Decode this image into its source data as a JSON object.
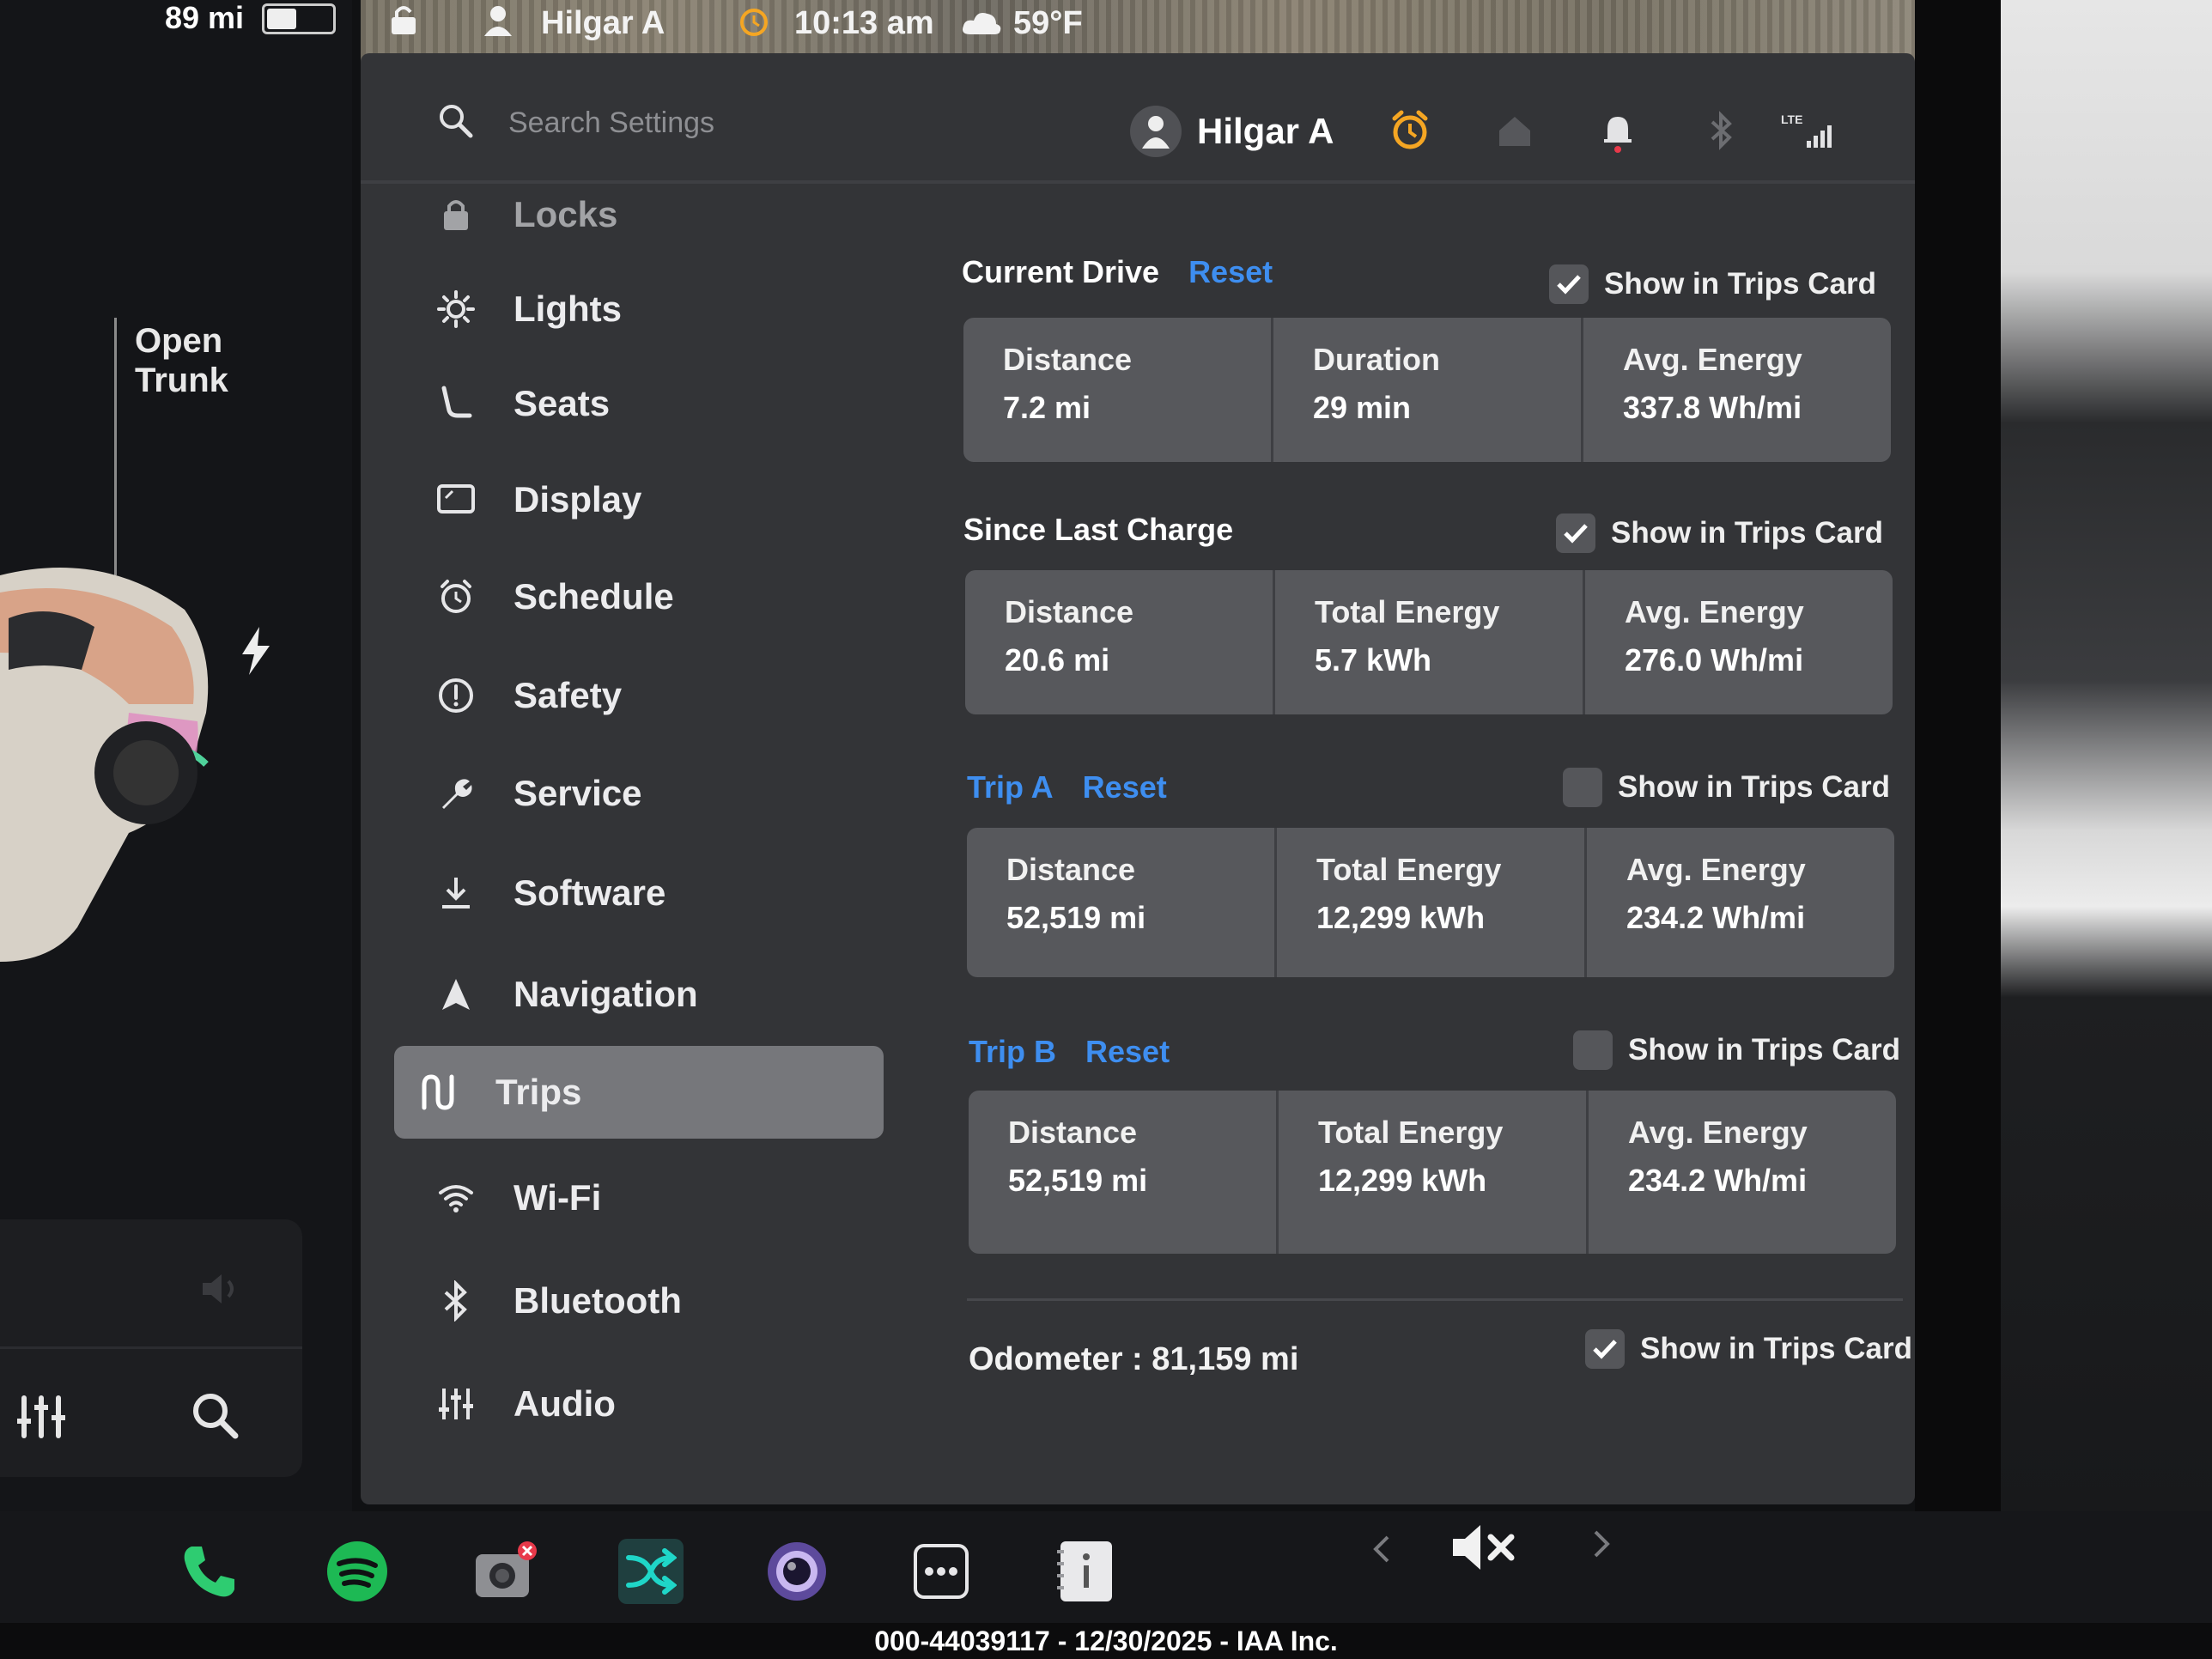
{
  "status_bar": {
    "range": "89 mi",
    "battery_level": 0.45,
    "user": "Hilgar A",
    "time": "10:13 am",
    "temperature": "59°F"
  },
  "left_panel": {
    "trunk_label_1": "Open",
    "trunk_label_2": "Trunk"
  },
  "header": {
    "search_placeholder": "Search Settings",
    "profile_name": "Hilgar A",
    "lte_label": "LTE"
  },
  "sidebar": {
    "items": [
      {
        "label": "Locks",
        "icon": "lock-icon"
      },
      {
        "label": "Lights",
        "icon": "sun-icon"
      },
      {
        "label": "Seats",
        "icon": "seat-icon"
      },
      {
        "label": "Display",
        "icon": "display-icon"
      },
      {
        "label": "Schedule",
        "icon": "alarm-clock-icon"
      },
      {
        "label": "Safety",
        "icon": "alert-circle-icon"
      },
      {
        "label": "Service",
        "icon": "wrench-icon"
      },
      {
        "label": "Software",
        "icon": "download-icon"
      },
      {
        "label": "Navigation",
        "icon": "navigation-arrow-icon"
      },
      {
        "label": "Trips",
        "icon": "trips-icon"
      },
      {
        "label": "Wi-Fi",
        "icon": "wifi-icon"
      },
      {
        "label": "Bluetooth",
        "icon": "bluetooth-icon"
      },
      {
        "label": "Audio",
        "icon": "equalizer-icon"
      }
    ],
    "active": "Trips"
  },
  "trips": {
    "reset_label": "Reset",
    "show_label": "Show in Trips Card",
    "current_drive": {
      "title": "Current Drive",
      "show": true,
      "stats": [
        {
          "label": "Distance",
          "value": "7.2 mi"
        },
        {
          "label": "Duration",
          "value": "29 min"
        },
        {
          "label": "Avg. Energy",
          "value": "337.8 Wh/mi"
        }
      ]
    },
    "since_last_charge": {
      "title": "Since Last Charge",
      "show": true,
      "stats": [
        {
          "label": "Distance",
          "value": "20.6 mi"
        },
        {
          "label": "Total Energy",
          "value": "5.7 kWh"
        },
        {
          "label": "Avg. Energy",
          "value": "276.0 Wh/mi"
        }
      ]
    },
    "trip_a": {
      "title": "Trip A",
      "show": false,
      "stats": [
        {
          "label": "Distance",
          "value": "52,519 mi"
        },
        {
          "label": "Total Energy",
          "value": "12,299 kWh"
        },
        {
          "label": "Avg. Energy",
          "value": "234.2 Wh/mi"
        }
      ]
    },
    "trip_b": {
      "title": "Trip B",
      "show": false,
      "stats": [
        {
          "label": "Distance",
          "value": "52,519 mi"
        },
        {
          "label": "Total Energy",
          "value": "12,299 kWh"
        },
        {
          "label": "Avg. Energy",
          "value": "234.2 Wh/mi"
        }
      ]
    },
    "odometer": "Odometer : 81,159 mi",
    "odometer_show": true
  },
  "taskbar": {
    "apps": [
      "phone-icon",
      "spotify-icon",
      "camera-icon",
      "shuffle-icon",
      "dashcam-icon",
      "more-icon",
      "manual-icon"
    ],
    "volume": "muted"
  },
  "footer": {
    "caption": "000-44039117 - 12/30/2025 - IAA Inc."
  },
  "colors": {
    "accent": "#3e8ef0",
    "panel": "#333437",
    "card": "#57585c",
    "alarm": "#f5a623",
    "phone": "#2ecc71",
    "spotify": "#1db954"
  }
}
